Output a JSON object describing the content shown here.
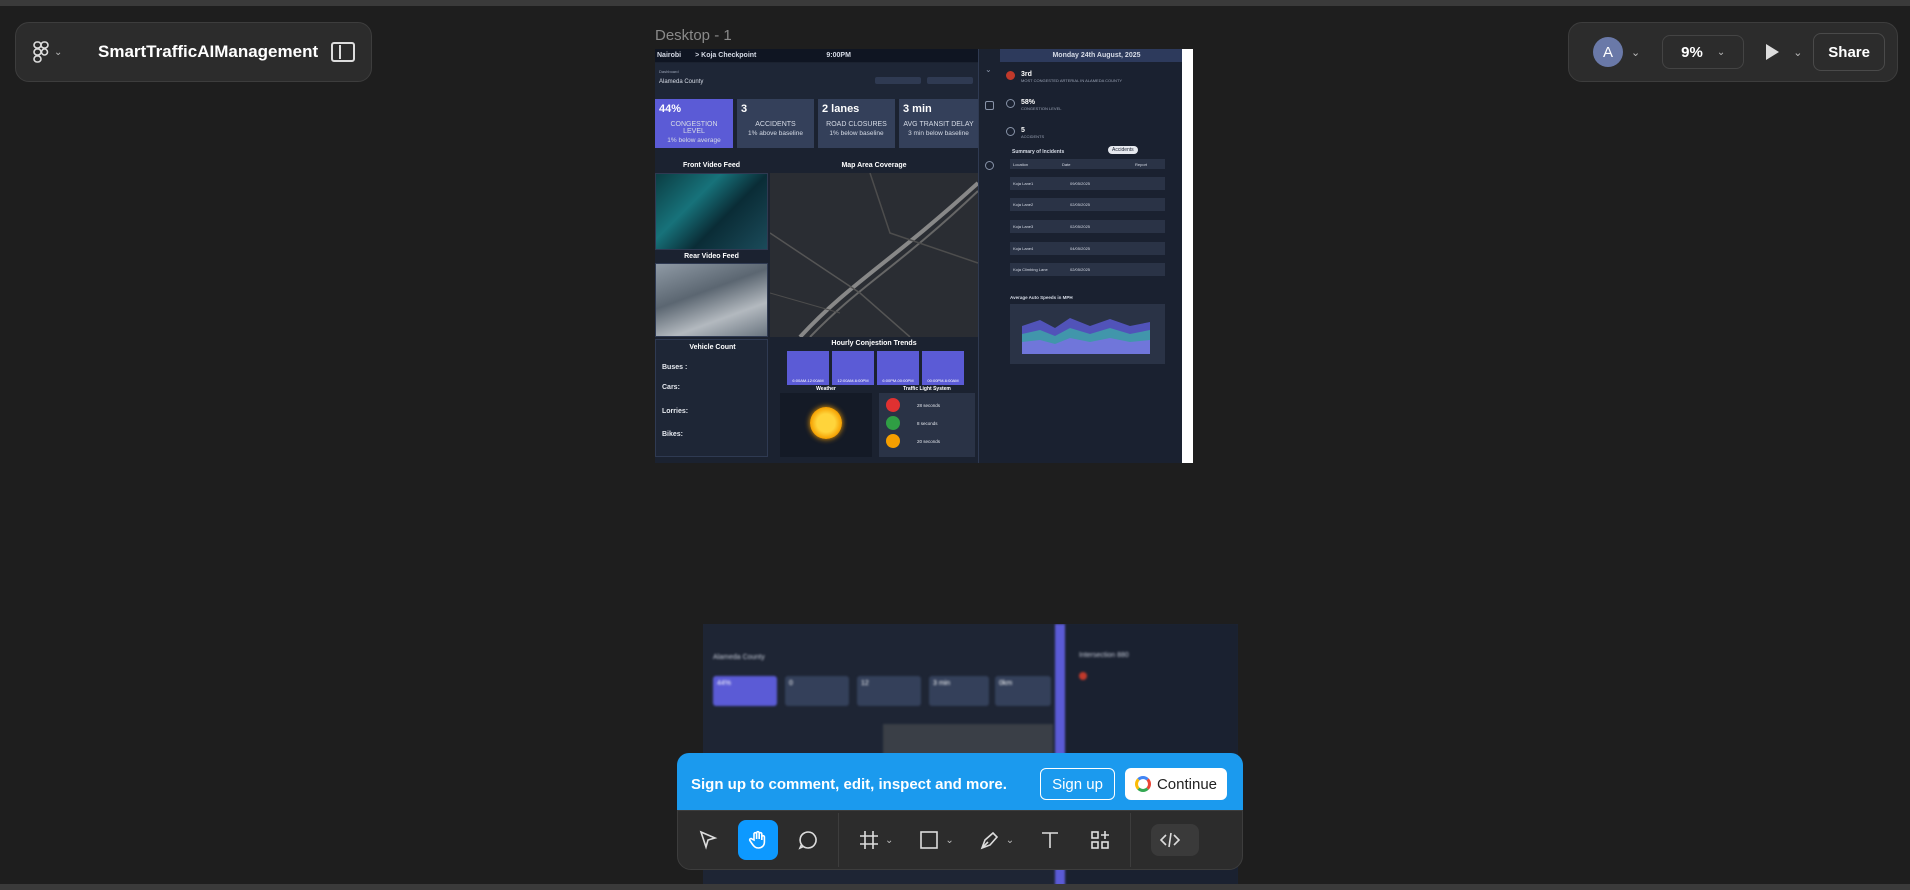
{
  "app": {
    "file_name": "SmartTrafficAIManagement",
    "avatar_letter": "A",
    "zoom": "9%",
    "share_label": "Share"
  },
  "canvas": {
    "frame_label": "Desktop - 1"
  },
  "dashboard": {
    "header_city": "Nairobi",
    "header_checkpoint": "> Koja Checkpoint",
    "header_time": "9:00PM",
    "dashboard_label": "Dashboard",
    "county": "Alameda County",
    "kpis": [
      {
        "value": "44%",
        "label": "CONGESTION LEVEL",
        "note": "1% below average"
      },
      {
        "value": "3",
        "label": "ACCIDENTS",
        "note": "1% above baseline"
      },
      {
        "value": "2 lanes",
        "label": "ROAD CLOSURES",
        "note": "1% below baseline"
      },
      {
        "value": "3 min",
        "label": "AVG TRANSIT DELAY",
        "note": "3 min below baseline"
      }
    ],
    "front_video_title": "Front Video Feed",
    "rear_video_title": "Rear Video Feed",
    "map_title": "Map Area Coverage",
    "vehicle_count_title": "Vehicle Count",
    "vehicle_rows": [
      "Buses :",
      "Cars:",
      "Lorries:",
      "Bikes:"
    ],
    "hourly_title": "Hourly Conjestion Trends",
    "hourly_bars": [
      "6:00AM-12:00AM",
      "12:00AM-6:00PM",
      "6:00PM-00:00PM",
      "00:00PM-6:00AM"
    ],
    "weather_title": "Weather",
    "traffic_light_title": "Traffic Light System",
    "traffic_lights": [
      {
        "color": "#e03131",
        "text": "28 seconds"
      },
      {
        "color": "#2f9e44",
        "text": "8 seconds"
      },
      {
        "color": "#f59f00",
        "text": "20 seconds"
      }
    ],
    "date": "Monday 24th August, 2025",
    "right_items": [
      {
        "big": "3rd",
        "small": "MOST CONGESTED ARTERIAL IN ALAMEDA COUNTY"
      },
      {
        "big": "58%",
        "small": "CONGESTION LEVEL"
      },
      {
        "big": "5",
        "small": "ACCIDENTS"
      }
    ],
    "incidents_title": "Summary of Incidents",
    "incidents_tab": "Accidents",
    "incidents_headers": [
      "Location",
      "Date",
      "Report"
    ],
    "incidents": [
      {
        "loc": "Koja Lane1",
        "date": "09/05/2025"
      },
      {
        "loc": "Koja Lane2",
        "date": "02/05/2025"
      },
      {
        "loc": "Koja Lane3",
        "date": "02/05/2025"
      },
      {
        "loc": "Koja Lane4",
        "date": "04/05/2025"
      },
      {
        "loc": "Koja Climbing Lane",
        "date": "02/05/2025"
      }
    ],
    "speed_chart_title": "Average Auto Speeds in MPH"
  },
  "frame2": {
    "title": "Intersection 880",
    "county": "Alameda County",
    "kpis": [
      "44%",
      "0",
      "12",
      "3 min",
      "0km"
    ]
  },
  "signup": {
    "text": "Sign up to comment, edit, inspect and more.",
    "signup_label": "Sign up",
    "continue_label": "Continue"
  },
  "colors": {
    "accent": "#0d99ff",
    "banner": "#1b9aee",
    "dashboard_purple": "#5b5bd6"
  }
}
